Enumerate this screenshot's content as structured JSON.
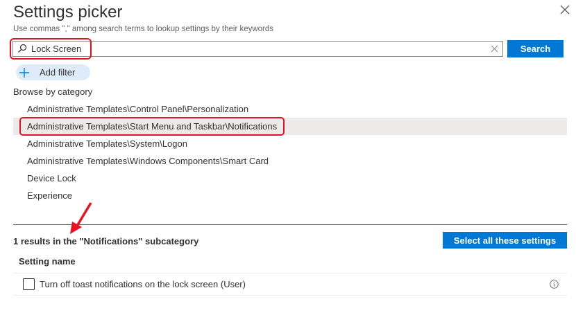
{
  "header": {
    "title": "Settings picker",
    "subtitle": "Use commas \",\" among search terms to lookup settings by their keywords"
  },
  "search": {
    "value": "Lock Screen",
    "button_label": "Search"
  },
  "filter": {
    "add_label": "Add filter"
  },
  "browse": {
    "label": "Browse by category",
    "categories": [
      "Administrative Templates\\Control Panel\\Personalization",
      "Administrative Templates\\Start Menu and Taskbar\\Notifications",
      "Administrative Templates\\System\\Logon",
      "Administrative Templates\\Windows Components\\Smart Card",
      "Device Lock",
      "Experience"
    ],
    "selected_index": 1
  },
  "results": {
    "summary": "1 results in the \"Notifications\" subcategory",
    "select_all_label": "Select all these settings",
    "column_header": "Setting name",
    "rows": [
      {
        "label": "Turn off toast notifications on the lock screen (User)",
        "checked": false
      }
    ]
  },
  "colors": {
    "accent": "#0078d4",
    "annotation": "#e81123",
    "selected_row": "#edebe9",
    "filter_pill": "#deecf9"
  },
  "icons": [
    "close-icon",
    "search-icon",
    "clear-icon",
    "plus-icon",
    "info-icon"
  ]
}
